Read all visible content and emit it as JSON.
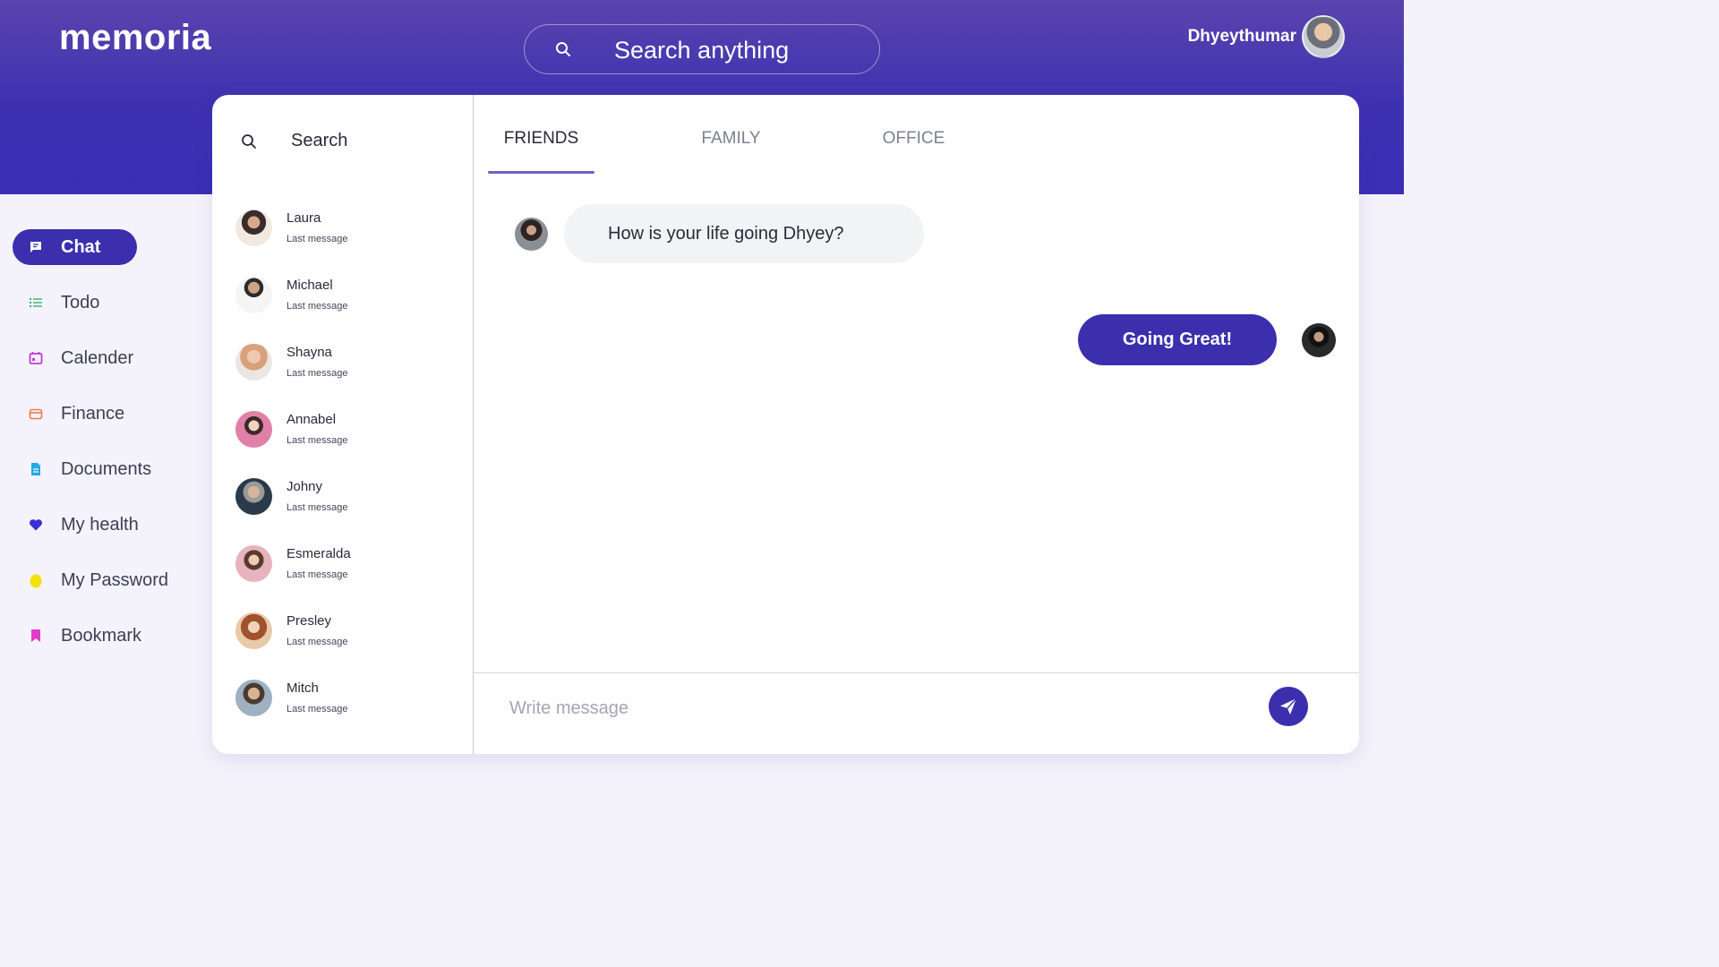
{
  "app": {
    "logo": "memoria"
  },
  "top_search": {
    "placeholder": "Search anything"
  },
  "user": {
    "name": "Dhyeythumar"
  },
  "nav": {
    "items": [
      {
        "label": "Chat",
        "icon": "chat-icon",
        "color": "#ffffff",
        "active": true
      },
      {
        "label": "Todo",
        "icon": "list-icon",
        "color": "#3bb36a"
      },
      {
        "label": "Calender",
        "icon": "calendar-icon",
        "color": "#c23bd4"
      },
      {
        "label": "Finance",
        "icon": "card-icon",
        "color": "#f07a4a"
      },
      {
        "label": "Documents",
        "icon": "document-icon",
        "color": "#27a9e6"
      },
      {
        "label": "My health",
        "icon": "heart-icon",
        "color": "#3a2fd6"
      },
      {
        "label": "My Password",
        "icon": "egg-icon",
        "color": "#f2e10a"
      },
      {
        "label": "Bookmark",
        "icon": "bookmark-icon",
        "color": "#e43ac8"
      }
    ]
  },
  "contacts": {
    "search_placeholder": "Search",
    "items": [
      {
        "name": "Laura",
        "last": "Last message"
      },
      {
        "name": "Michael",
        "last": "Last message"
      },
      {
        "name": "Shayna",
        "last": "Last message"
      },
      {
        "name": "Annabel",
        "last": "Last message"
      },
      {
        "name": "Johny",
        "last": "Last message"
      },
      {
        "name": "Esmeralda",
        "last": "Last message"
      },
      {
        "name": "Presley",
        "last": "Last message"
      },
      {
        "name": "Mitch",
        "last": "Last message"
      }
    ]
  },
  "tabs": [
    {
      "label": "FRIENDS",
      "active": true
    },
    {
      "label": "FAMILY"
    },
    {
      "label": "OFFICE"
    }
  ],
  "messages": {
    "incoming": "How is your life going Dhyey?",
    "outgoing": "Going Great!"
  },
  "composer": {
    "placeholder": "Write message"
  },
  "colors": {
    "accent": "#3b2fae",
    "header_top": "#5a44ad",
    "header_bottom": "#3a2fb5"
  }
}
